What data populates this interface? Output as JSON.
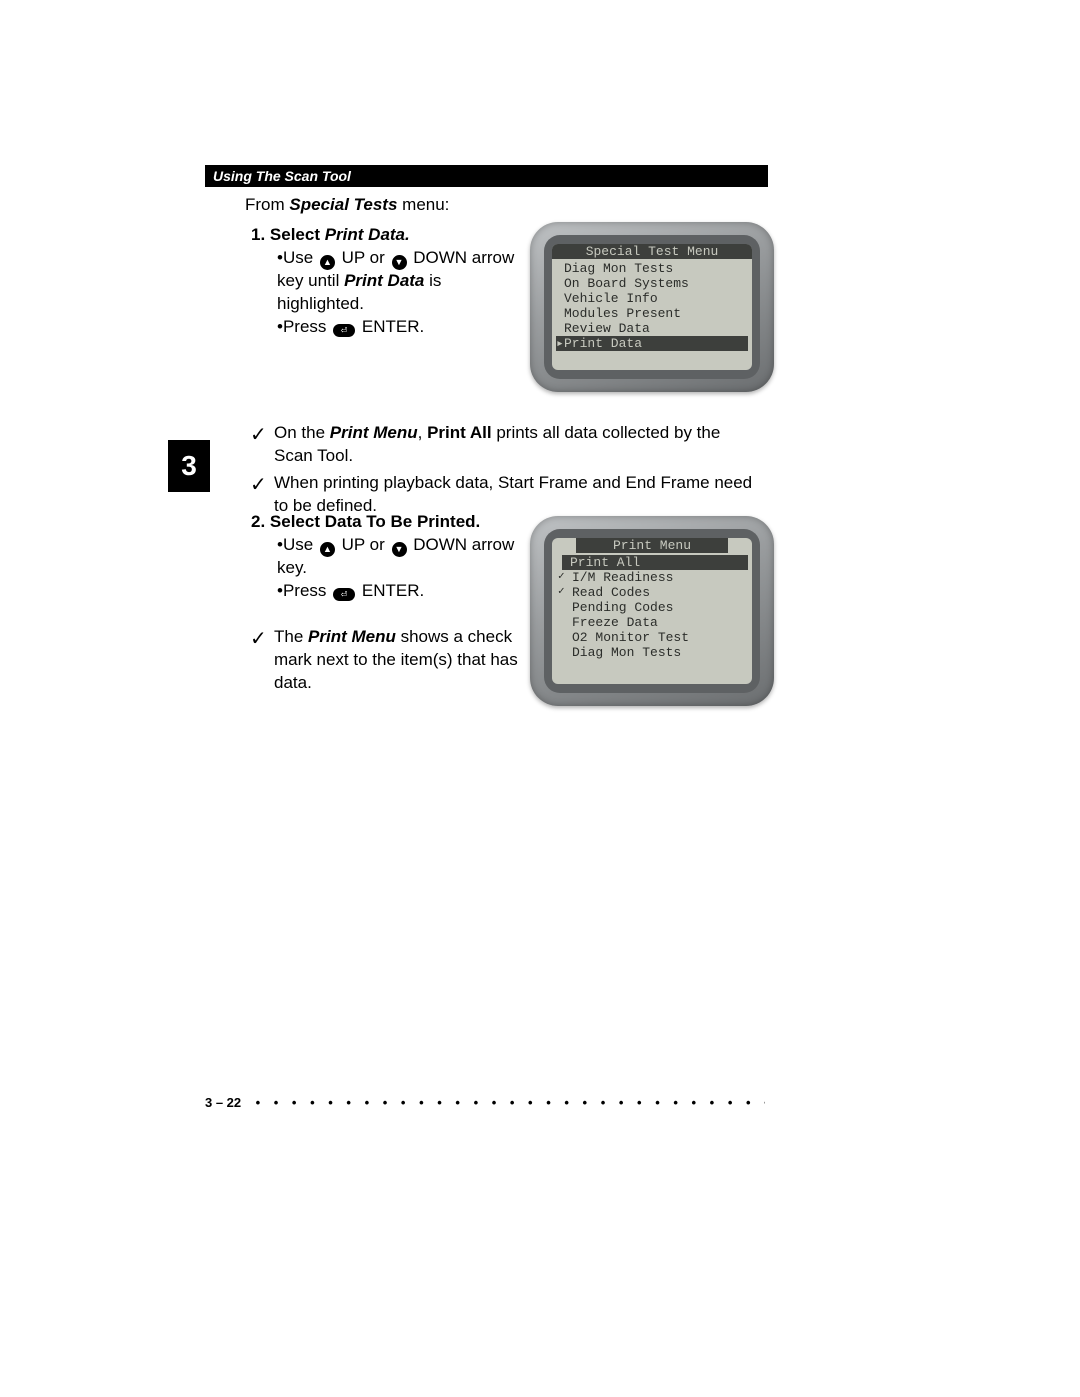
{
  "header": {
    "title": "Using The Scan Tool"
  },
  "chapter_tab": "3",
  "intro": {
    "prefix": "From ",
    "bold": "Special Tests",
    "suffix": " menu:"
  },
  "step1": {
    "label": "1. Select ",
    "italic": "Print Data.",
    "line1_prefix": "Use ",
    "up_icon": "▲",
    "line1_mid": " UP or ",
    "down_icon": "▼",
    "line1_suffix": " DOWN arrow key until ",
    "line1_bold": "Print Data",
    "line1_end": " is highlighted.",
    "line2_prefix": "Press ",
    "enter_glyph": "⏎",
    "line2_text": " ENTER."
  },
  "device1": {
    "title": "Special Test Menu",
    "items": [
      {
        "label": "Diag Mon Tests",
        "selected": false,
        "marker": ""
      },
      {
        "label": "On Board Systems",
        "selected": false,
        "marker": ""
      },
      {
        "label": "Vehicle Info",
        "selected": false,
        "marker": ""
      },
      {
        "label": "Modules Present",
        "selected": false,
        "marker": ""
      },
      {
        "label": "Review Data",
        "selected": false,
        "marker": ""
      },
      {
        "label": "Print Data",
        "selected": true,
        "marker": "▸"
      }
    ]
  },
  "midchecks": {
    "c1_pre": "On the ",
    "c1_b1": "Print Menu",
    "c1_mid": ", ",
    "c1_b2": "Print All",
    "c1_end": " prints all data collected by the Scan Tool.",
    "c2": "When printing playback data, Start Frame and End Frame need to be defined."
  },
  "step2": {
    "label": "2. Select Data To Be Printed.",
    "line1_prefix": "Use ",
    "up_icon": "▲",
    "line1_mid": " UP or ",
    "down_icon": "▼",
    "line1_suffix": " DOWN arrow key.",
    "line2_prefix": "Press ",
    "enter_glyph": "⏎",
    "line2_text": " ENTER."
  },
  "device2": {
    "title": "Print Menu",
    "items": [
      {
        "label": "Print All",
        "selected": true,
        "marker": "▸",
        "check": ""
      },
      {
        "label": "I/M Readiness",
        "selected": false,
        "marker": "",
        "check": "✓"
      },
      {
        "label": "Read Codes",
        "selected": false,
        "marker": "",
        "check": "✓"
      },
      {
        "label": "Pending Codes",
        "selected": false,
        "marker": "",
        "check": ""
      },
      {
        "label": "Freeze Data",
        "selected": false,
        "marker": "",
        "check": ""
      },
      {
        "label": "O2 Monitor Test",
        "selected": false,
        "marker": "",
        "check": ""
      },
      {
        "label": "Diag Mon Tests",
        "selected": false,
        "marker": "",
        "check": ""
      }
    ]
  },
  "lowercheck": {
    "pre": "The ",
    "bold": "Print Menu",
    "end": " shows a check mark next to the item(s) that has data."
  },
  "footer": {
    "page": "3 – 22",
    "dots": "• • • • • • • • • • • • • • • • • • • • • • • • • • • • • • • • • • • • • • • • • • • • • • • • • • • • •"
  }
}
